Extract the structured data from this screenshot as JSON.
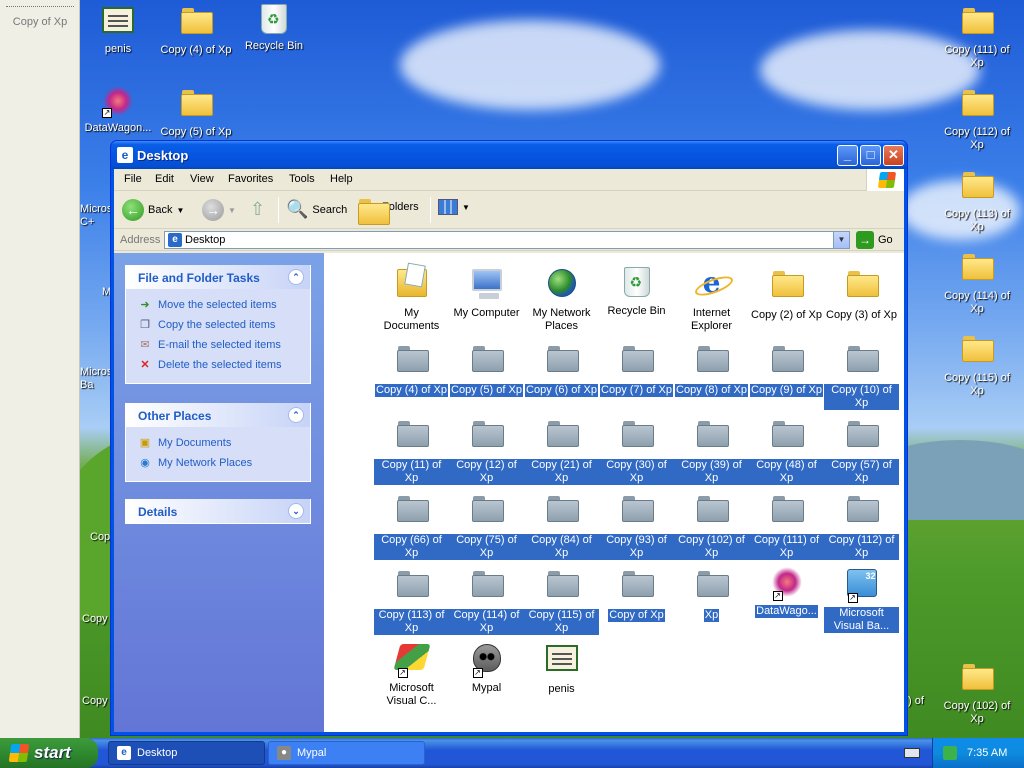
{
  "desktop": {
    "left_panel_label": "Copy of Xp",
    "icons": [
      {
        "label": "penis"
      },
      {
        "label": "Copy (4) of Xp"
      },
      {
        "label": "Recycle Bin"
      },
      {
        "label": "DataWagon..."
      },
      {
        "label": "Copy (5) of Xp"
      },
      {
        "label": "Copy (111) of Xp"
      },
      {
        "label": "Copy (112) of Xp"
      },
      {
        "label": "Copy (113) of Xp"
      },
      {
        "label": "Copy (114) of Xp"
      },
      {
        "label": "Copy (115) of Xp"
      },
      {
        "label": "Copy (102) of Xp"
      }
    ],
    "partial_labels": [
      "Micros C+",
      "M",
      "Micros Ba",
      "Cop",
      "Copy",
      "Copy",
      ") of"
    ]
  },
  "window": {
    "title": "Desktop",
    "menu": [
      "File",
      "Edit",
      "View",
      "Favorites",
      "Tools",
      "Help"
    ],
    "toolbar": {
      "back": "Back",
      "search": "Search",
      "folders": "Folders"
    },
    "address": {
      "label": "Address",
      "value": "Desktop",
      "go": "Go"
    },
    "tasks": {
      "file_folder_title": "File and Folder Tasks",
      "file_folder_items": [
        "Move the selected items",
        "Copy the selected items",
        "E-mail the selected items",
        "Delete the selected items"
      ],
      "other_places_title": "Other Places",
      "other_places_items": [
        "My Documents",
        "My Network Places"
      ],
      "details_title": "Details"
    },
    "items": [
      {
        "label": "My Documents",
        "selected": false
      },
      {
        "label": "My Computer",
        "selected": false
      },
      {
        "label": "My Network Places",
        "selected": false
      },
      {
        "label": "Recycle Bin",
        "selected": false
      },
      {
        "label": "Internet Explorer",
        "selected": false
      },
      {
        "label": "Copy (2) of Xp",
        "selected": false
      },
      {
        "label": "Copy (3) of Xp",
        "selected": false
      },
      {
        "label": "Copy (4) of Xp",
        "selected": true
      },
      {
        "label": "Copy (5) of Xp",
        "selected": true
      },
      {
        "label": "Copy (6) of Xp",
        "selected": true
      },
      {
        "label": "Copy (7) of Xp",
        "selected": true
      },
      {
        "label": "Copy (8) of Xp",
        "selected": true
      },
      {
        "label": "Copy (9) of Xp",
        "selected": true
      },
      {
        "label": "Copy (10) of Xp",
        "selected": true
      },
      {
        "label": "Copy (11) of Xp",
        "selected": true
      },
      {
        "label": "Copy (12) of Xp",
        "selected": true
      },
      {
        "label": "Copy (21) of Xp",
        "selected": true
      },
      {
        "label": "Copy (30) of Xp",
        "selected": true
      },
      {
        "label": "Copy (39) of Xp",
        "selected": true
      },
      {
        "label": "Copy (48) of Xp",
        "selected": true
      },
      {
        "label": "Copy (57) of Xp",
        "selected": true
      },
      {
        "label": "Copy (66) of Xp",
        "selected": true
      },
      {
        "label": "Copy (75) of Xp",
        "selected": true
      },
      {
        "label": "Copy (84) of Xp",
        "selected": true
      },
      {
        "label": "Copy (93) of Xp",
        "selected": true
      },
      {
        "label": "Copy (102) of Xp",
        "selected": true
      },
      {
        "label": "Copy (111) of Xp",
        "selected": true
      },
      {
        "label": "Copy (112) of Xp",
        "selected": true
      },
      {
        "label": "Copy (113) of Xp",
        "selected": true
      },
      {
        "label": "Copy (114) of Xp",
        "selected": true
      },
      {
        "label": "Copy (115) of Xp",
        "selected": true
      },
      {
        "label": "Copy of Xp",
        "selected": true
      },
      {
        "label": "Xp",
        "selected": true
      },
      {
        "label": "DataWago...",
        "selected": true
      },
      {
        "label": "Microsoft Visual Ba...",
        "selected": true
      },
      {
        "label": "Microsoft Visual C...",
        "selected": false
      },
      {
        "label": "Mypal",
        "selected": false
      },
      {
        "label": "penis",
        "selected": false
      }
    ]
  },
  "taskbar": {
    "start": "start",
    "tasks": [
      {
        "label": "Desktop"
      },
      {
        "label": "Mypal"
      }
    ],
    "clock": "7:35 AM"
  }
}
